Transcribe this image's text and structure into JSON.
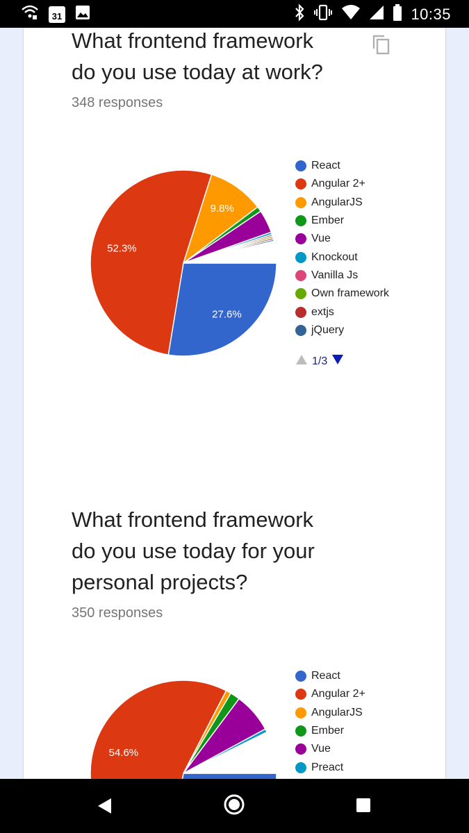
{
  "status_bar": {
    "time": "10:35",
    "calendar_day": "31",
    "icons_left": [
      "wifi-call-icon",
      "calendar-icon",
      "image-icon"
    ],
    "icons_right": [
      "bluetooth-icon",
      "vibrate-icon",
      "wifi-icon",
      "signal-icon",
      "battery-icon"
    ]
  },
  "questions": [
    {
      "title_lines": [
        "What frontend framework",
        "do you use today at work?"
      ],
      "responses": "348 responses",
      "pager": "1/3",
      "chart_data": {
        "type": "pie",
        "slices": [
          {
            "name": "React",
            "value": 27.6,
            "color": "#3366cc",
            "label": "27.6%"
          },
          {
            "name": "Angular 2+",
            "value": 52.3,
            "color": "#dc3912",
            "label": "52.3%"
          },
          {
            "name": "AngularJS",
            "value": 9.8,
            "color": "#ff9900",
            "label": "9.8%"
          },
          {
            "name": "Ember",
            "value": 0.9,
            "color": "#109618",
            "label": ""
          },
          {
            "name": "Vue",
            "value": 4.0,
            "color": "#990099",
            "label": ""
          },
          {
            "name": "Knockout",
            "value": 0.4,
            "color": "#0099c6",
            "label": ""
          },
          {
            "name": "Vanilla Js",
            "value": 0.3,
            "color": "#dd4477",
            "label": ""
          },
          {
            "name": "Own framework",
            "value": 0.3,
            "color": "#66aa00",
            "label": ""
          },
          {
            "name": "extjs",
            "value": 0.3,
            "color": "#b82e2e",
            "label": ""
          },
          {
            "name": "jQuery",
            "value": 0.3,
            "color": "#316395",
            "label": ""
          },
          {
            "name": "",
            "value": 3.8,
            "color": "#ffffff",
            "label": ""
          }
        ],
        "legend": [
          "React",
          "Angular 2+",
          "AngularJS",
          "Ember",
          "Vue",
          "Knockout",
          "Vanilla Js",
          "Own framework",
          "extjs",
          "jQuery"
        ]
      }
    },
    {
      "title_lines": [
        "What frontend framework",
        "do you use today for your",
        "personal projects?"
      ],
      "responses": "350 responses",
      "chart_data": {
        "type": "pie",
        "slices": [
          {
            "name": "React",
            "value": 28.0,
            "color": "#3366cc",
            "label": ""
          },
          {
            "name": "Angular 2+",
            "value": 54.6,
            "color": "#dc3912",
            "label": "54.6%"
          },
          {
            "name": "AngularJS",
            "value": 0.9,
            "color": "#ff9900",
            "label": ""
          },
          {
            "name": "Ember",
            "value": 1.7,
            "color": "#109618",
            "label": ""
          },
          {
            "name": "Vue",
            "value": 6.9,
            "color": "#990099",
            "label": ""
          },
          {
            "name": "Preact",
            "value": 0.6,
            "color": "#0099c6",
            "label": ""
          },
          {
            "name": "",
            "value": 7.3,
            "color": "#ffffff",
            "label": ""
          }
        ],
        "legend": [
          "React",
          "Angular 2+",
          "AngularJS",
          "Ember",
          "Vue",
          "Preact"
        ]
      }
    }
  ]
}
